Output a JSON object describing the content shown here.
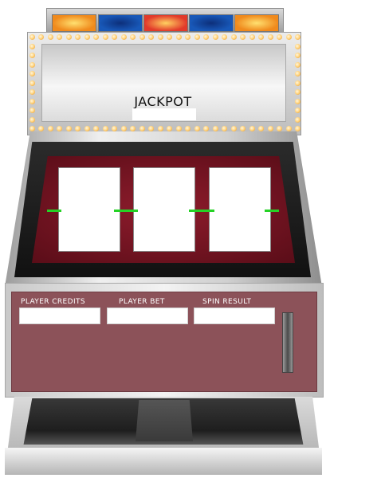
{
  "marquee": {
    "title": "JACKPOT"
  },
  "lamps": [
    {
      "color": "#f08a1c",
      "center": "#ffe070"
    },
    {
      "color": "#1858b8",
      "center": "#0d2f7a"
    },
    {
      "color": "#e23a2a",
      "center": "#ffd060"
    },
    {
      "color": "#1858b8",
      "center": "#0d2f7a"
    },
    {
      "color": "#f08a1c",
      "center": "#ffe070"
    }
  ],
  "reels": [
    "",
    "",
    ""
  ],
  "fields": [
    {
      "label": "PLAYER CREDITS",
      "value": ""
    },
    {
      "label": "PLAYER BET",
      "value": ""
    },
    {
      "label": "SPIN RESULT",
      "value": ""
    }
  ],
  "colors": {
    "payline": "#25d225",
    "cabinet_panel": "#8c5259",
    "reel_panel": "#7a1625"
  }
}
